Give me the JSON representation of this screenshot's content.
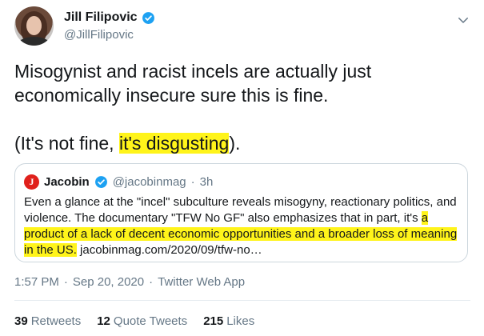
{
  "author": {
    "display_name": "Jill Filipovic",
    "handle": "@JillFilipovic",
    "verified": true
  },
  "tweet": {
    "line1": "Misogynist and racist incels are actually just economically insecure sure this is fine.",
    "para2_before": "(It's not fine, ",
    "para2_highlight": "it's disgusting",
    "para2_after": ")."
  },
  "quoted_tweet": {
    "display_name": "Jacobin",
    "handle": "@jacobinmag",
    "separator": "·",
    "time": "3h",
    "avatar_letter": "J",
    "text_plain": "Even a glance at the \"incel\" subculture reveals misogyny, reactionary politics, and violence. The documentary \"TFW No GF\" also emphasizes that in part, it's ",
    "text_highlight": "a product of a lack of decent economic opportunities and a broader loss of meaning in the US.",
    "link": "jacobinmag.com/2020/09/tfw-no…"
  },
  "meta": {
    "time": "1:57 PM",
    "date": "Sep 20, 2020",
    "sep": "·",
    "source": "Twitter Web App"
  },
  "stats": {
    "retweets_count": "39",
    "retweets_label": "Retweets",
    "quotes_count": "12",
    "quotes_label": "Quote Tweets",
    "likes_count": "215",
    "likes_label": "Likes"
  },
  "colors": {
    "highlight": "#fff41a",
    "verified": "#1da1f2",
    "jacobin": "#e0201b",
    "muted": "#657786"
  }
}
